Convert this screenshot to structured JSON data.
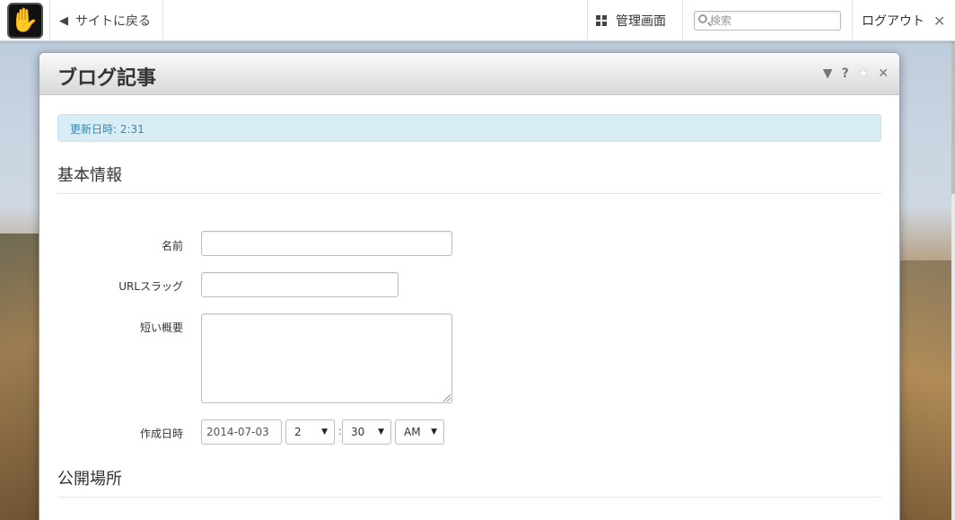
{
  "toolbar": {
    "back_label": "サイトに戻る",
    "dashboard_label": "管理画面",
    "search_placeholder": "検索",
    "logout_label": "ログアウト"
  },
  "icons": {
    "logo": "concrete5-hand-logo",
    "back": "left-arrow-icon",
    "dashboard": "grid-icon",
    "search": "magnifier-icon",
    "logout_close": "close-icon",
    "panel": [
      "chevron-down-icon",
      "help-icon",
      "star-icon",
      "close-icon"
    ]
  },
  "panel": {
    "title": "ブログ記事",
    "alert": "更新日時: 2:31",
    "section_basic": "基本情報",
    "section_publish": "公開場所",
    "fields": {
      "name_label": "名前",
      "slug_label": "URLスラッグ",
      "description_label": "短い概要",
      "date_label": "作成日時",
      "date_value": "2014-07-03",
      "hour_value": "2",
      "minute_value": "30",
      "ampm_value": "AM"
    }
  },
  "colors": {
    "alert_bg": "#d9edf7",
    "alert_text": "#3a87ad",
    "toolbar_bg": "#ffffff"
  }
}
